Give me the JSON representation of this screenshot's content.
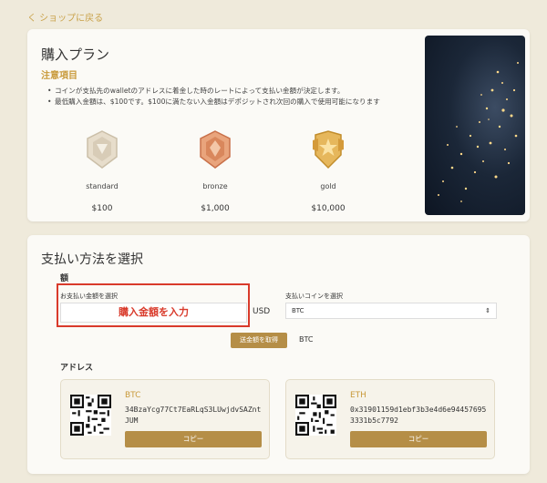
{
  "nav": {
    "back_label": "く ショップに戻る"
  },
  "plan": {
    "title": "購入プラン",
    "notice_title": "注意項目",
    "notices": [
      "コインが支払先のwalletのアドレスに着金した時のレートによって支払い金額が決定します。",
      "最低購入金額は、$100です。$100に満たない入金額はデポジットされ次回の購入で使用可能になります"
    ],
    "tiers": [
      {
        "name": "standard",
        "price": "$100",
        "color": "#d8ccb7",
        "icon": "standard-medal-icon"
      },
      {
        "name": "bronze",
        "price": "$1,000",
        "color": "#d9875c",
        "icon": "bronze-medal-icon"
      },
      {
        "name": "gold",
        "price": "$10,000",
        "color": "#d9a94a",
        "icon": "gold-medal-icon"
      }
    ]
  },
  "payment": {
    "title": "支払い方法を選択",
    "amount_label": "額",
    "input_label": "お支払い金額を選択",
    "input_annotation": "購入金額を入力",
    "currency": "USD",
    "coin_label": "支払いコインを選択",
    "coin_selected": "BTC",
    "get_amount_button": "送金額を取得",
    "coin_result": "BTC",
    "address_label": "アドレス",
    "addresses": [
      {
        "coin": "BTC",
        "address": "34BzaYcg77Ct7EaRLqS3LUwjdvSAZntJUM",
        "copy_label": "コピー"
      },
      {
        "coin": "ETH",
        "address": "0x31901159d1ebf3b3e4d6e944576953331b5c7792",
        "copy_label": "コピー"
      }
    ]
  },
  "colors": {
    "accent": "#b58e47",
    "highlight": "#d93a2b",
    "background": "#efeadb"
  }
}
